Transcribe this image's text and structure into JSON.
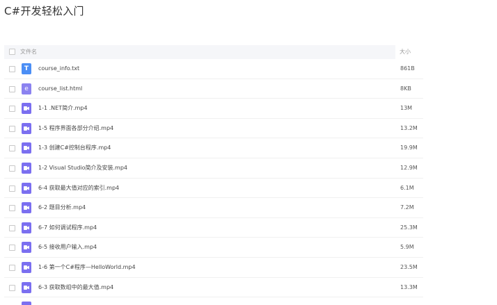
{
  "page": {
    "title": "C#开发轻松入门"
  },
  "table": {
    "header": {
      "name": "文件名",
      "size": "大小"
    },
    "rows": [
      {
        "name": "course_info.txt",
        "size": "861B",
        "icon": "txt-file-icon"
      },
      {
        "name": "course_list.html",
        "size": "8KB",
        "icon": "html-file-icon"
      },
      {
        "name": "1-1 .NET简介.mp4",
        "size": "13M",
        "icon": "video-file-icon"
      },
      {
        "name": "1-5 程序界面各部分介绍.mp4",
        "size": "13.2M",
        "icon": "video-file-icon"
      },
      {
        "name": "1-3 创建C#控制台程序.mp4",
        "size": "19.9M",
        "icon": "video-file-icon"
      },
      {
        "name": "1-2 Visual Studio简介及安装.mp4",
        "size": "12.9M",
        "icon": "video-file-icon"
      },
      {
        "name": "6-4 获取最大值对应的索引.mp4",
        "size": "6.1M",
        "icon": "video-file-icon"
      },
      {
        "name": "6-2 题目分析.mp4",
        "size": "7.2M",
        "icon": "video-file-icon"
      },
      {
        "name": "6-7 如何调试程序.mp4",
        "size": "25.3M",
        "icon": "video-file-icon"
      },
      {
        "name": "6-5 接收用户输入.mp4",
        "size": "5.9M",
        "icon": "video-file-icon"
      },
      {
        "name": "1-6 第一个C#程序—HelloWorld.mp4",
        "size": "23.5M",
        "icon": "video-file-icon"
      },
      {
        "name": "6-3 获取数组中的最大值.mp4",
        "size": "13.3M",
        "icon": "video-file-icon"
      }
    ]
  },
  "colors": {
    "txt_icon": "#4b8ef5",
    "html_icon": "#8b82f0",
    "video_icon": "#7b6ff0",
    "header_bg": "#f5f6f9"
  }
}
